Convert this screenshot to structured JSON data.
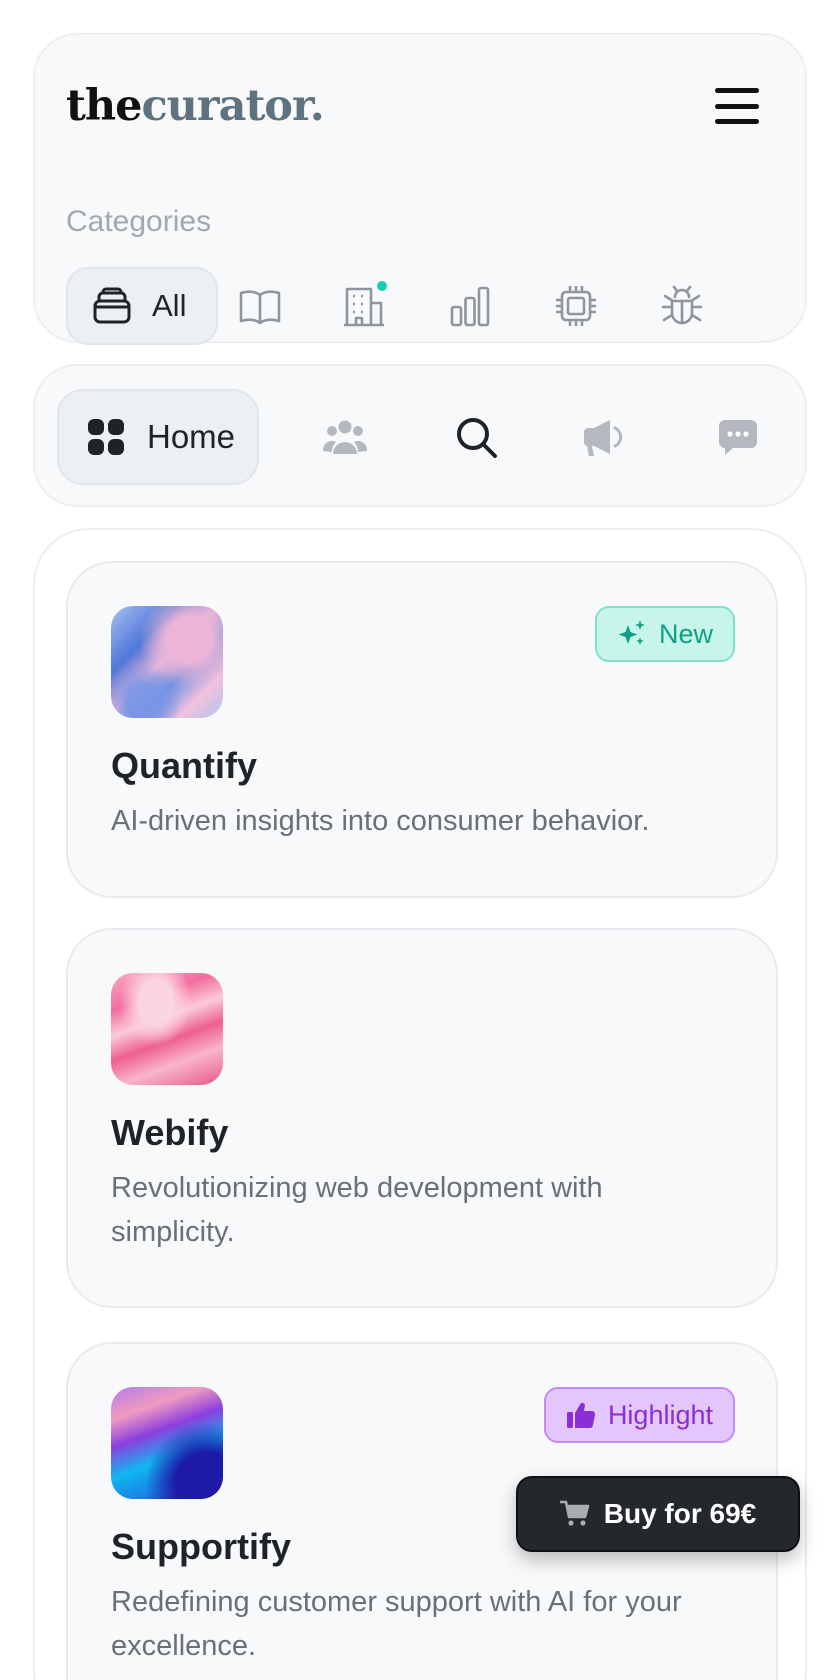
{
  "brand": {
    "part1": "the",
    "part2": "curator."
  },
  "header": {
    "menu_icon": "hamburger-menu-icon"
  },
  "categories": {
    "label": "Categories",
    "items": [
      {
        "label": "All",
        "icon": "stack-icon",
        "active": true
      },
      {
        "icon": "book-icon"
      },
      {
        "icon": "building-icon",
        "has_notification": true
      },
      {
        "icon": "bar-chart-icon"
      },
      {
        "icon": "cpu-chip-icon"
      },
      {
        "icon": "bug-icon"
      }
    ]
  },
  "nav": {
    "items": [
      {
        "label": "Home",
        "icon": "grid-icon",
        "active": true
      },
      {
        "icon": "users-icon"
      },
      {
        "icon": "search-icon"
      },
      {
        "icon": "megaphone-icon"
      },
      {
        "icon": "chat-bubble-icon"
      }
    ]
  },
  "products": [
    {
      "name": "Quantify",
      "description": "AI-driven insights into consumer behavior.",
      "badge": "New",
      "badge_icon": "sparkles-icon"
    },
    {
      "name": "Webify",
      "description": "Revolutionizing web development with simplicity."
    },
    {
      "name": "Supportify",
      "description": "Redefining customer support with AI for your excellence.",
      "badge": "Highlight",
      "badge_icon": "thumbs-up-icon"
    }
  ],
  "buy_button": {
    "label": "Buy for 69€",
    "icon": "cart-icon"
  },
  "colors": {
    "accent_teal": "#17d0b8",
    "badge_new_text": "#0f9f84",
    "badge_highlight_text": "#8a2fd8",
    "buy_button_bg": "#24272b"
  }
}
